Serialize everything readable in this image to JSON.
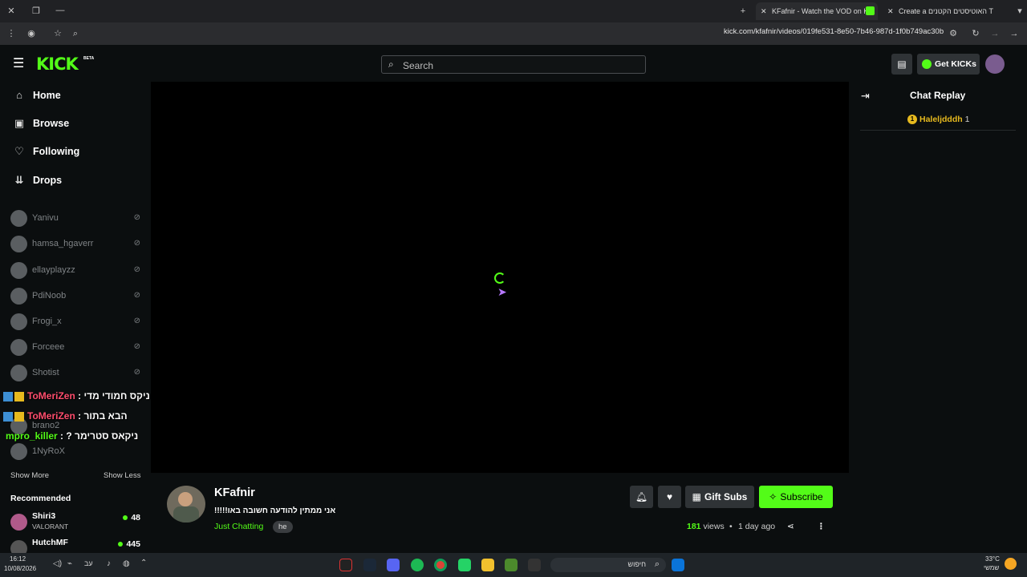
{
  "browser": {
    "tabs": [
      {
        "title": "KFafnir - Watch the VOD on Kic",
        "active": true
      },
      {
        "title": "Create a האוטיסטים הקטנים T",
        "active": false
      }
    ],
    "url": "kick.com/kfafnir/videos/019fe531-8e50-7b46-987d-1f0b749ac30b"
  },
  "header": {
    "logo": "KICK",
    "logo_badge": "BETA",
    "search_placeholder": "Search",
    "get_kicks_label": "Get KICKs"
  },
  "sidebar": {
    "nav": [
      {
        "label": "Home",
        "icon": "home-icon",
        "glyph": "⌂"
      },
      {
        "label": "Browse",
        "icon": "browse-icon",
        "glyph": "▣"
      },
      {
        "label": "Following",
        "icon": "heart-icon",
        "glyph": "♡"
      },
      {
        "label": "Drops",
        "icon": "drops-icon",
        "glyph": "⇊"
      }
    ],
    "channels": [
      "Yanivu",
      "hamsa_hgaverr",
      "ellayplayzz",
      "PdiNoob",
      "Frogi_x",
      "Forceee",
      "Shotist",
      "brano2",
      "1NyRoX"
    ],
    "show_more": "Show More",
    "show_less": "Show Less",
    "recommended_title": "Recommended",
    "recommended": [
      {
        "name": "Shiri3",
        "game": "VALORANT",
        "viewers": "48"
      },
      {
        "name": "HutchMF",
        "game": "",
        "viewers": "445"
      }
    ]
  },
  "overlay_chat": [
    {
      "user": "ToMeriZen",
      "sep": ":",
      "msg": "ניקס חמודי מדי",
      "color": "#ff4d6d"
    },
    {
      "user": "ToMeriZen",
      "sep": ":",
      "msg": "הבא בתור",
      "color": "#ff4d6d"
    },
    {
      "user": "mpro_killer",
      "sep": ":",
      "msg": "ניקאס סטרימר ?",
      "color": "#53fc18"
    }
  ],
  "stream": {
    "name": "KFafnir",
    "title": "אני ממתין להודעה חשובה באו!!!!!",
    "category": "Just Chatting",
    "tag": "he",
    "gift_label": "Gift Subs",
    "subscribe_label": "Subscribe",
    "views_count": "181",
    "views_label": "views",
    "bullet": "•",
    "time_ago": "1 day ago"
  },
  "chat": {
    "title": "Chat Replay",
    "top_gifter": {
      "rank": "1",
      "name": "Haleljdddh",
      "count": "1"
    }
  },
  "taskbar": {
    "time": "16:12",
    "date": "10/08/2026",
    "search_label": "חיפוש",
    "weather_temp": "33°C",
    "weather_desc": "שמשי",
    "lang": "עב"
  },
  "colors": {
    "accent": "#53fc18",
    "bg": "#0b0e0f"
  }
}
